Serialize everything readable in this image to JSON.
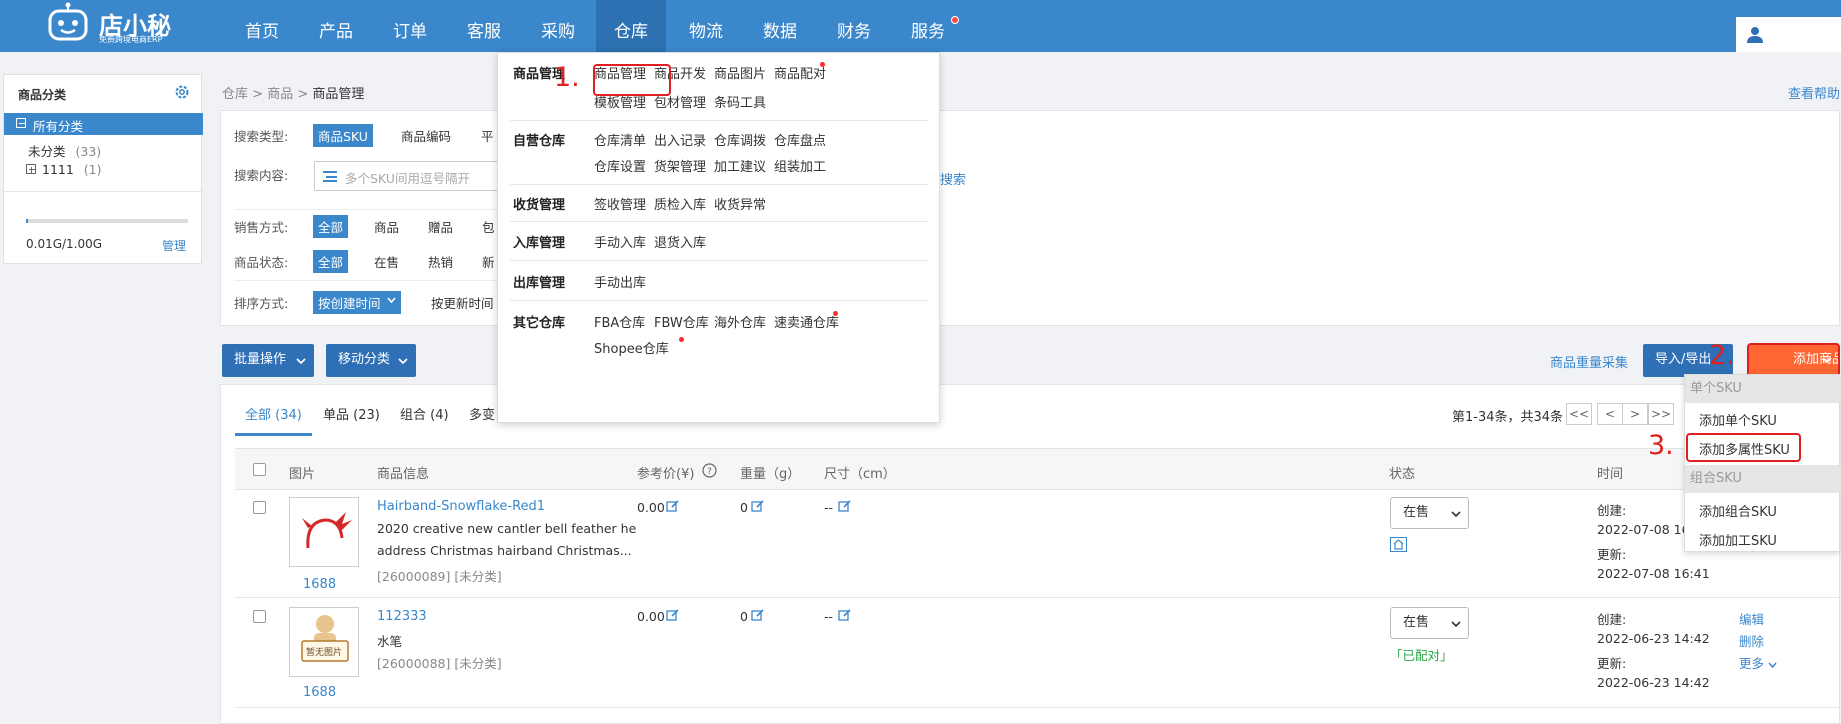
{
  "header": {
    "logo_text": "店小秘",
    "logo_sub": "免费跨境电商ERP",
    "nav": [
      "首页",
      "产品",
      "订单",
      "客服",
      "采购",
      "仓库",
      "物流",
      "数据",
      "财务",
      "服务"
    ]
  },
  "sidebar": {
    "title": "商品分类",
    "all": "所有分类",
    "uncat": "未分类",
    "uncat_count": "(33)",
    "cat1": "1111",
    "cat1_count": "(1)",
    "storage": "0.01G/1.00G",
    "storage_used_fraction": 0.01,
    "manage": "管理"
  },
  "breadcrumb": [
    "仓库",
    "商品",
    "商品管理"
  ],
  "help": "查看帮助",
  "filters": {
    "search_type_label": "搜索类型:",
    "search_type_options": [
      "商品SKU",
      "商品编码",
      "平"
    ],
    "search_content_label": "搜索内容:",
    "search_placeholder": "多个SKU间用逗号隔开",
    "search_btn_partial": "搜索",
    "sale_label": "销售方式:",
    "sale_options": [
      "全部",
      "商品",
      "赠品",
      "包"
    ],
    "status_label": "商品状态:",
    "status_options": [
      "全部",
      "在售",
      "热销",
      "新"
    ],
    "sort_label": "排序方式:",
    "sort_options": [
      "按创建时间",
      "按更新时间"
    ]
  },
  "toolbar": {
    "batch": "批量操作",
    "move": "移动分类",
    "weight_collect": "商品重量采集",
    "import_export": "导入/导出",
    "add_product": "添加商品"
  },
  "tabs": [
    "全部 (34)",
    "单品 (23)",
    "组合 (4)",
    "多变"
  ],
  "pagination": {
    "summary": "第1-34条，共34条",
    "buttons": [
      "<<",
      "<",
      ">",
      ">>"
    ]
  },
  "table": {
    "headers": [
      "图片",
      "商品信息",
      "参考价(¥)",
      "重量（g）",
      "尺寸（cm）",
      "状态",
      "时间"
    ],
    "rows": [
      {
        "name": "Hairband-Snowflake-Red1",
        "desc1": "2020 creative new cantler bell feather he",
        "desc2": "address Christmas hairband Christmas...",
        "meta": "[26000089] [未分类]",
        "img_caption": "1688",
        "price": "0.00",
        "weight": "0",
        "size": "--",
        "status": "在售",
        "created_label": "创建:",
        "created": "2022-07-08 16",
        "updated_label": "更新:",
        "updated": "2022-07-08 16:41"
      },
      {
        "name": "112333",
        "desc1": "水笔",
        "meta": "[26000088] [未分类]",
        "img_caption": "1688",
        "img_placeholder": "暂无图片",
        "price": "0.00",
        "weight": "0",
        "size": "--",
        "status": "在售",
        "paired": "「已配对」",
        "created_label": "创建:",
        "created": "2022-06-23 14:42",
        "updated_label": "更新:",
        "updated": "2022-06-23 14:42",
        "actions": [
          "编辑",
          "删除",
          "更多"
        ]
      }
    ]
  },
  "mega_menu": {
    "sections": [
      {
        "title": "商品管理",
        "items": [
          "商品管理",
          "商品开发",
          "商品图片",
          "商品配对",
          "模板管理",
          "包材管理",
          "条码工具"
        ]
      },
      {
        "title": "自营仓库",
        "items": [
          "仓库清单",
          "出入记录",
          "仓库调拨",
          "仓库盘点",
          "仓库设置",
          "货架管理",
          "加工建议",
          "组装加工"
        ]
      },
      {
        "title": "收货管理",
        "items": [
          "签收管理",
          "质检入库",
          "收货异常"
        ]
      },
      {
        "title": "入库管理",
        "items": [
          "手动入库",
          "退货入库"
        ]
      },
      {
        "title": "出库管理",
        "items": [
          "手动出库"
        ]
      },
      {
        "title": "其它仓库",
        "items": [
          "FBA仓库",
          "FBW仓库",
          "海外仓库",
          "速卖通仓库",
          "Shopee仓库"
        ]
      }
    ]
  },
  "dropdown": {
    "groups": [
      "单个SKU",
      "组合SKU"
    ],
    "items": [
      "添加单个SKU",
      "添加多属性SKU",
      "添加组合SKU",
      "添加加工SKU"
    ]
  },
  "annotations": [
    "1.",
    "2.",
    "3."
  ],
  "colors": {
    "topbar": "#3b87cc",
    "accent": "#3b87cc",
    "annotation": "#e02020",
    "add_button": "#ff6633"
  }
}
